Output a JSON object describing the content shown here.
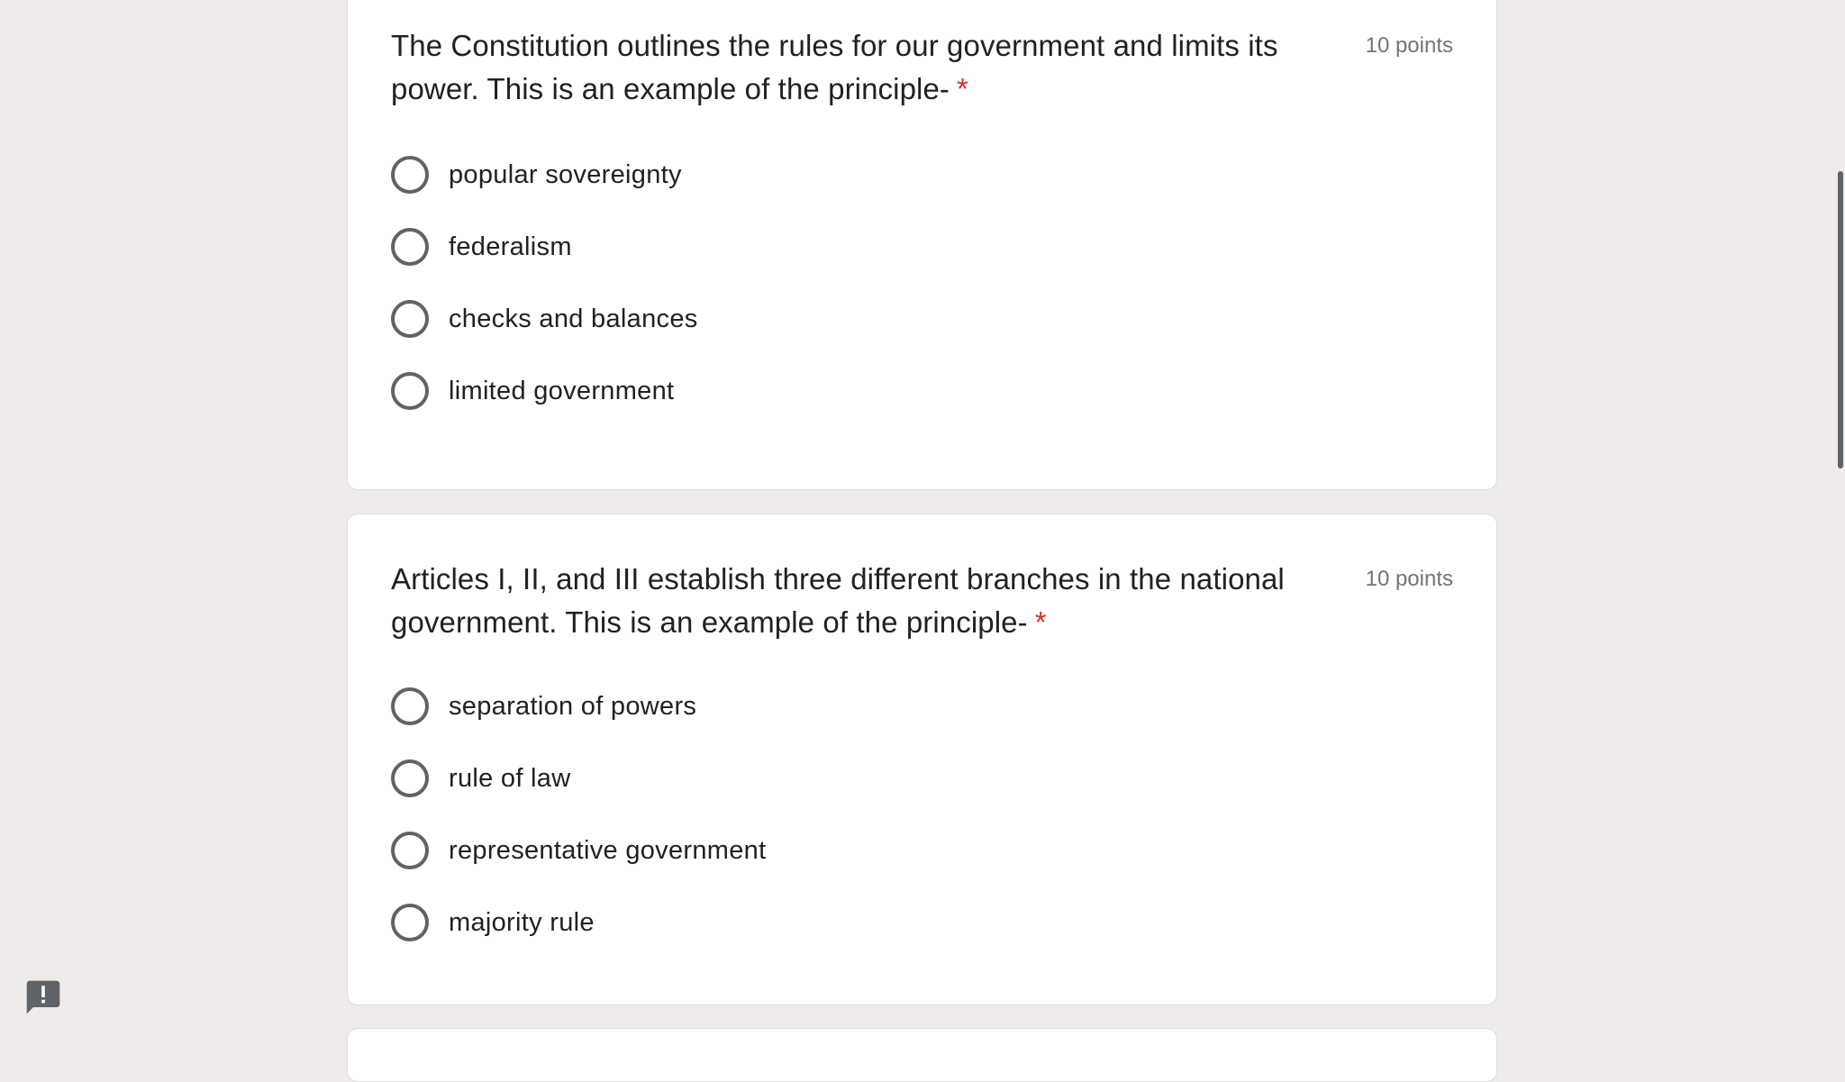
{
  "questions": [
    {
      "title": "The Constitution outlines the rules for our government and limits its power. This is an example of the principle-",
      "required_mark": "*",
      "points": "10 points",
      "options": [
        "popular sovereignty",
        "federalism",
        "checks and balances",
        "limited government"
      ]
    },
    {
      "title": "Articles I, II, and III establish three different branches in the national government. This is an example of the principle-",
      "required_mark": "*",
      "points": "10 points",
      "options": [
        "separation of powers",
        "rule of law",
        "representative government",
        "majority rule"
      ]
    }
  ],
  "icons": {
    "radio": "radio-unchecked-icon",
    "feedback": "feedback-icon"
  },
  "colors": {
    "background": "#f0ebeb",
    "card": "#ffffff",
    "required": "#d93025",
    "radio_border": "#5f6368",
    "points_text": "#70757a"
  }
}
